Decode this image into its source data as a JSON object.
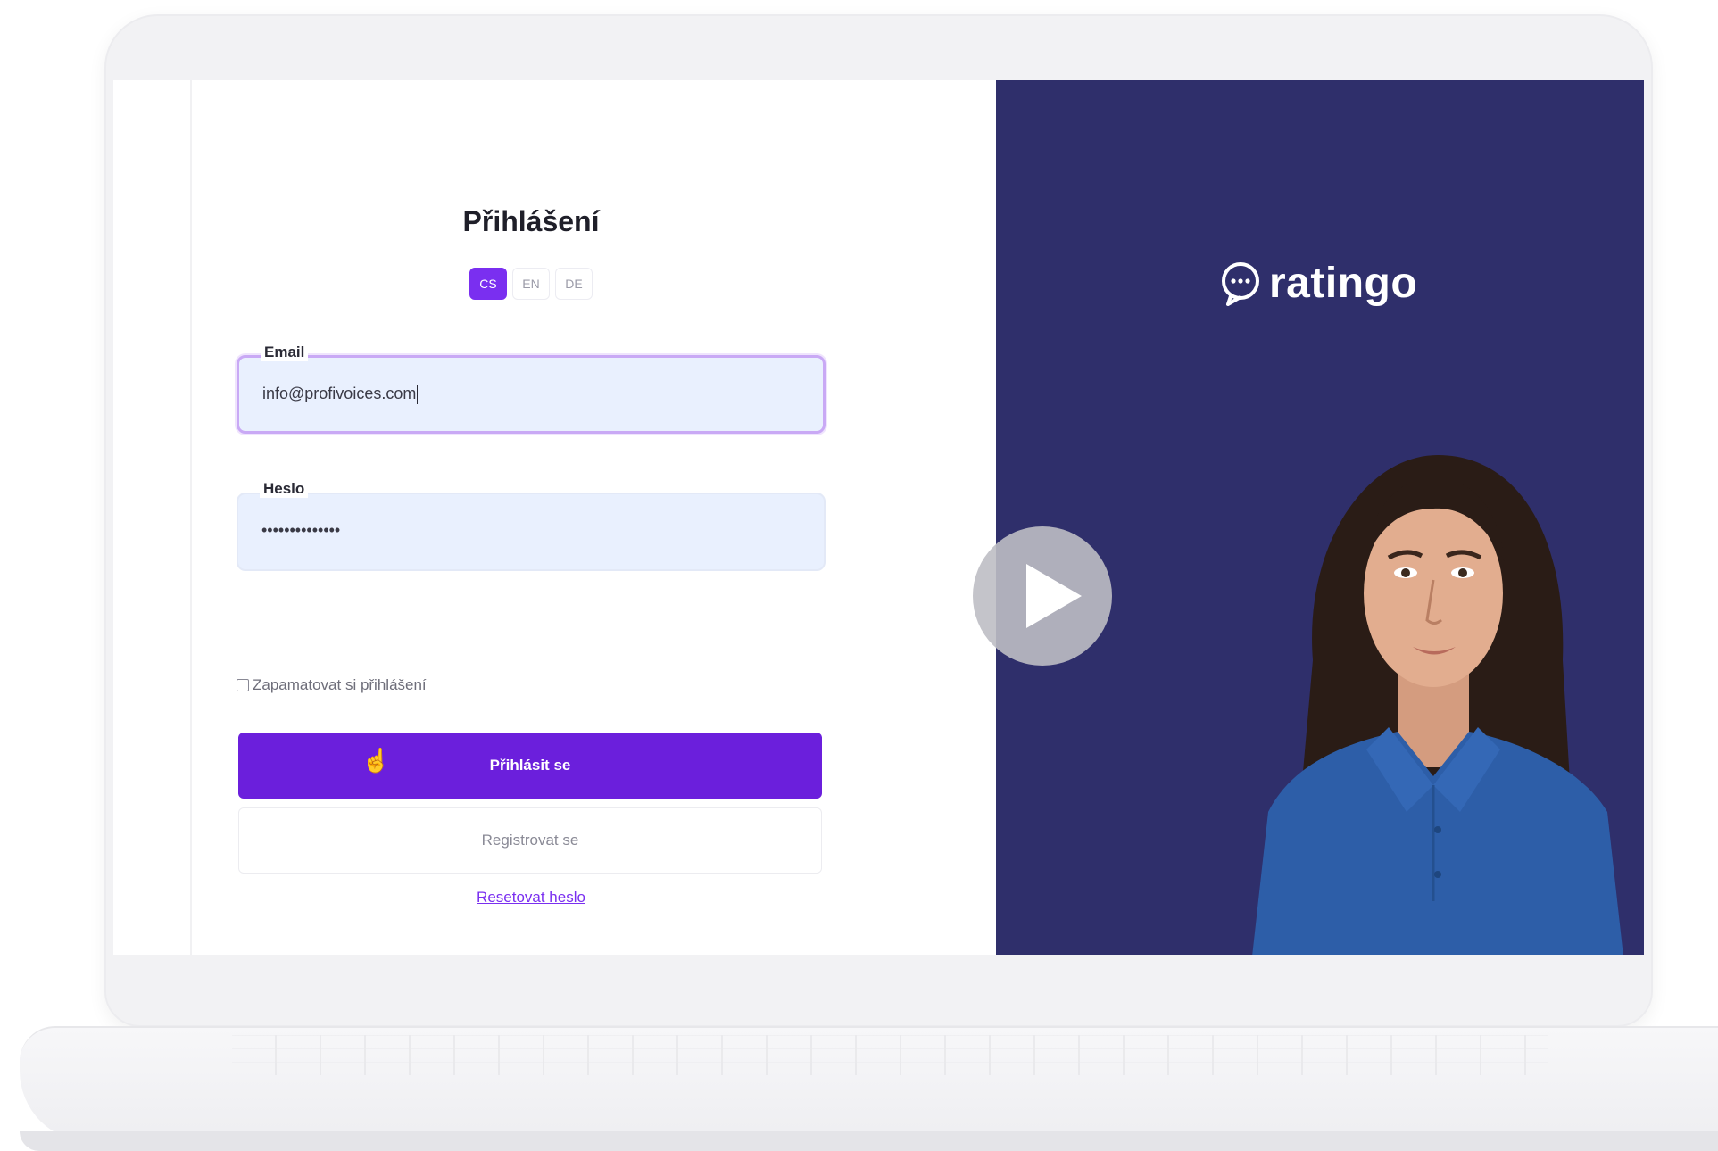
{
  "login": {
    "title": "Přihlášení",
    "languages": [
      {
        "code": "CS",
        "active": true
      },
      {
        "code": "EN",
        "active": false
      },
      {
        "code": "DE",
        "active": false
      }
    ],
    "email": {
      "label": "Email",
      "value": "info@profivoices.com"
    },
    "password": {
      "label": "Heslo",
      "value": "••••••••••••••"
    },
    "remember_label": "Zapamatovat si přihlášení",
    "submit_label": "Přihlásit se",
    "register_label": "Registrovat se",
    "reset_label": "Resetovat heslo"
  },
  "brand": {
    "name": "ratingo",
    "logo_icon": "chat-bubble-icon",
    "panel_color": "#2f2f6b"
  },
  "colors": {
    "accent": "#6b1fdc",
    "accent_light": "#7a2ff0",
    "field_bg": "#e9f0fe"
  },
  "video": {
    "play_icon": "play-icon"
  }
}
